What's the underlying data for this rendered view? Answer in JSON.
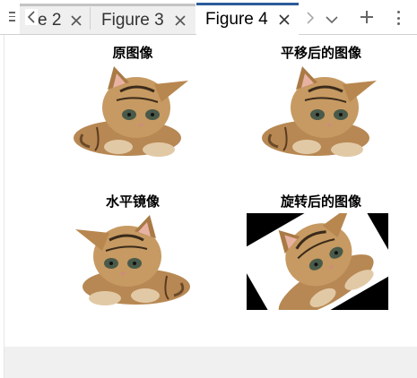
{
  "tabs": [
    {
      "label": "e 2",
      "active": false
    },
    {
      "label": "Figure 3",
      "active": false
    },
    {
      "label": "Figure 4",
      "active": true
    }
  ],
  "icons": {
    "menu": "menu-icon",
    "scroll_left": "chevron-left-icon",
    "close": "close-icon",
    "scroll_right": "chevron-right-icon",
    "overflow": "chevron-down-icon",
    "add": "plus-icon",
    "more": "kebab-menu-icon"
  },
  "colors": {
    "active_tab_accent": "#2b5b9a",
    "inactive_tab_bg": "#efefef",
    "footer_bg": "#f0f0f0"
  },
  "figure": {
    "subplots": [
      {
        "title": "原图像",
        "image": "kitten-photo"
      },
      {
        "title": "平移后的图像",
        "image": "kitten-photo-translated"
      },
      {
        "title": "水平镜像",
        "image": "kitten-photo-mirrored"
      },
      {
        "title": "旋转后的图像",
        "image": "kitten-photo-rotated"
      }
    ]
  }
}
